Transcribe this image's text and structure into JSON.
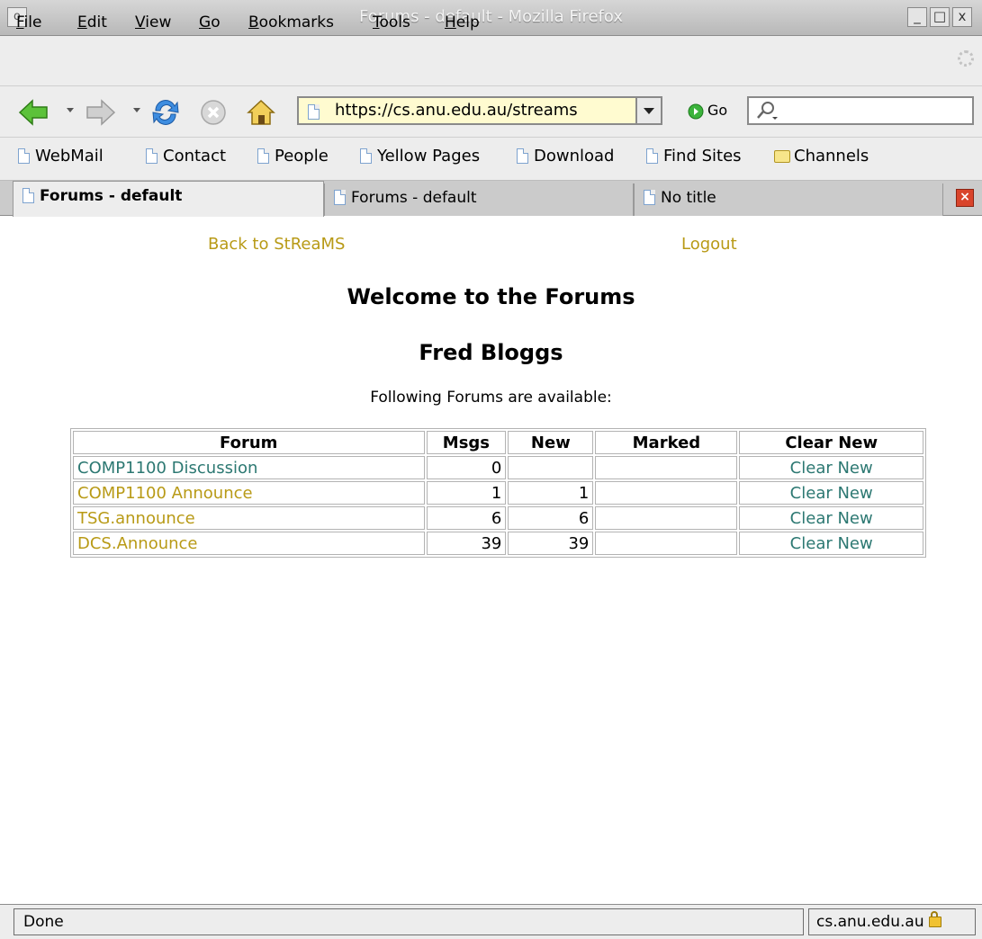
{
  "window": {
    "title": "Forums - default - Mozilla Firefox",
    "menu_glyph": "o",
    "minimize": "_",
    "maximize": "□",
    "close": "x"
  },
  "menubar": {
    "items": [
      {
        "key": "F",
        "rest": "ile"
      },
      {
        "key": "E",
        "rest": "dit"
      },
      {
        "key": "V",
        "rest": "iew"
      },
      {
        "key": "G",
        "rest": "o"
      },
      {
        "key": "B",
        "rest": "ookmarks"
      },
      {
        "key": "T",
        "rest": "ools"
      },
      {
        "key": "H",
        "rest": "elp"
      }
    ]
  },
  "navbar": {
    "url": "https://cs.anu.edu.au/streams",
    "go_label": "Go",
    "search_value": ""
  },
  "bookmarks": [
    {
      "label": "WebMail",
      "icon": "page-icon"
    },
    {
      "label": "Contact",
      "icon": "page-icon"
    },
    {
      "label": "People",
      "icon": "page-icon"
    },
    {
      "label": "Yellow Pages",
      "icon": "page-icon"
    },
    {
      "label": "Download",
      "icon": "page-icon"
    },
    {
      "label": "Find Sites",
      "icon": "page-icon"
    },
    {
      "label": "Channels",
      "icon": "folder-icon"
    }
  ],
  "tabs": [
    {
      "label": "Forums - default",
      "active": true
    },
    {
      "label": "Forums - default",
      "active": false
    },
    {
      "label": "No title",
      "active": false
    }
  ],
  "page": {
    "back_link": "Back to StReaMS",
    "logout_link": "Logout",
    "heading": "Welcome to the Forums",
    "user_name": "Fred Bloggs",
    "subtitle": "Following Forums are available:",
    "link_colors": {
      "visited": "#b89a16",
      "unvisited": "#2c7872"
    },
    "table": {
      "headers": [
        "Forum",
        "Msgs",
        "New",
        "Marked",
        "Clear New"
      ],
      "rows": [
        {
          "forum": "COMP1100 Discussion",
          "msgs": "0",
          "new": "",
          "marked": "",
          "clear": "Clear New",
          "visited": false
        },
        {
          "forum": "COMP1100 Announce",
          "msgs": "1",
          "new": "1",
          "marked": "",
          "clear": "Clear New",
          "visited": true
        },
        {
          "forum": "TSG.announce",
          "msgs": "6",
          "new": "6",
          "marked": "",
          "clear": "Clear New",
          "visited": true
        },
        {
          "forum": "DCS.Announce",
          "msgs": "39",
          "new": "39",
          "marked": "",
          "clear": "Clear New",
          "visited": true
        }
      ]
    }
  },
  "status": {
    "text": "Done",
    "host": "cs.anu.edu.au"
  }
}
